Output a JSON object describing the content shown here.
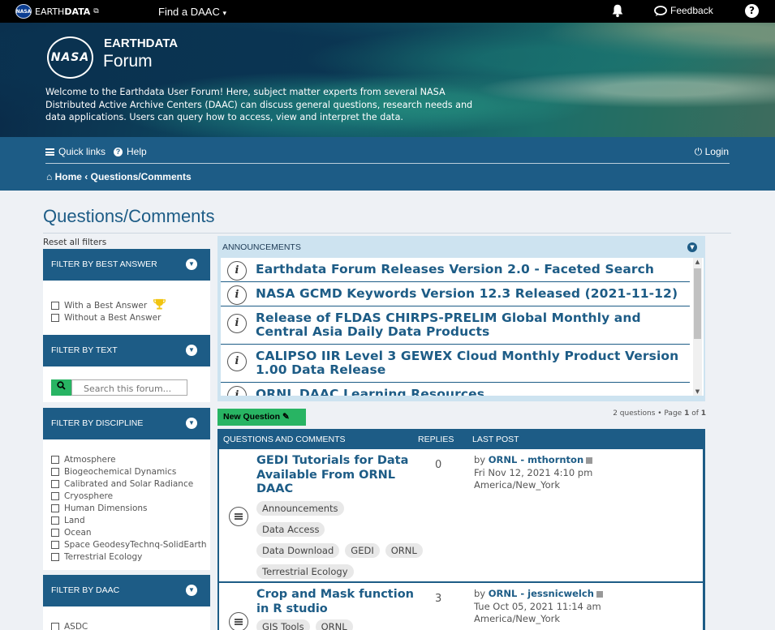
{
  "topbar": {
    "logo_prefix": "EARTH",
    "logo_bold": "DATA",
    "find_daac": "Find a DAAC",
    "feedback": "Feedback"
  },
  "hero": {
    "nasa_mark": "NASA",
    "title_line1": "EARTHDATA",
    "title_line2": "Forum",
    "welcome": "Welcome to the Earthdata User Forum! Here, subject matter experts from several NASA Distributed Active Archive Centers (DAAC) can discuss general questions, research needs and data applications. Users can query how to access, view and interpret the data."
  },
  "nav": {
    "quick_links": "Quick links",
    "help": "Help",
    "login": "Login",
    "home": "Home",
    "current": "Questions/Comments"
  },
  "page": {
    "title": "Questions/Comments",
    "reset_filters": "Reset all filters"
  },
  "filters": {
    "best_answer": {
      "header": "FILTER BY BEST ANSWER",
      "options": [
        "With a Best Answer",
        "Without a Best Answer"
      ]
    },
    "text": {
      "header": "FILTER BY TEXT",
      "search_button": "Q",
      "placeholder": "Search this forum..."
    },
    "discipline": {
      "header": "FILTER BY DISCIPLINE",
      "options": [
        "Atmosphere",
        "Biogeochemical Dynamics",
        "Calibrated and Solar Radiance",
        "Cryosphere",
        "Human Dimensions",
        "Land",
        "Ocean",
        "Space GeodesyTechnq-SolidEarth",
        "Terrestrial Ecology"
      ]
    },
    "daac": {
      "header": "FILTER BY DAAC",
      "options": [
        "ASDC"
      ]
    }
  },
  "announcements": {
    "header": "ANNOUNCEMENTS",
    "items": [
      "Earthdata Forum Releases Version 2.0 - Faceted Search",
      "NASA GCMD Keywords Version 12.3 Released (2021-11-12)",
      "Release of FLDAS CHIRPS-PRELIM Global Monthly and Central Asia Daily Data Products",
      "CALIPSO IIR Level 3 GEWEX Cloud Monthly Product Version 1.00 Data Release",
      "ORNL DAAC Learning Resources"
    ]
  },
  "toolbar": {
    "new_question": "New Question",
    "page_info_prefix": "2 questions • Page ",
    "page_current": "1",
    "page_of": " of ",
    "page_total": "1"
  },
  "topics": {
    "headers": {
      "col1": "QUESTIONS AND COMMENTS",
      "col2": "REPLIES",
      "col3": "LAST POST"
    },
    "rows": [
      {
        "title": "GEDI Tutorials for Data Available From ORNL DAAC",
        "tags": [
          "Announcements",
          "Data Access",
          "Data Download",
          "GEDI",
          "ORNL",
          "Terrestrial Ecology"
        ],
        "replies": "0",
        "by": "by",
        "author": "ORNL - mthornton",
        "date": "Fri Nov 12, 2021 4:10 pm",
        "tz": "America/New_York"
      },
      {
        "title": "Crop and Mask function in R studio",
        "tags": [
          "GIS Tools",
          "ORNL"
        ],
        "replies": "3",
        "by": "by",
        "author": "ORNL - jessnicwelch",
        "date": "Tue Oct 05, 2021 11:14 am",
        "tz": "America/New_York"
      }
    ]
  },
  "colors": {
    "brand_blue": "#1d5c86",
    "action_green": "#28b463",
    "announcement_bg": "#cde3f0"
  },
  "icons": [
    "nasa-logo-icon",
    "external-link-icon",
    "chevron-down-icon",
    "bell-icon",
    "feedback-icon",
    "help-icon",
    "hamburger-icon",
    "question-icon",
    "power-icon",
    "home-icon",
    "trophy-icon",
    "search-icon",
    "info-icon",
    "pencil-icon",
    "topic-icon",
    "goto-post-icon"
  ]
}
